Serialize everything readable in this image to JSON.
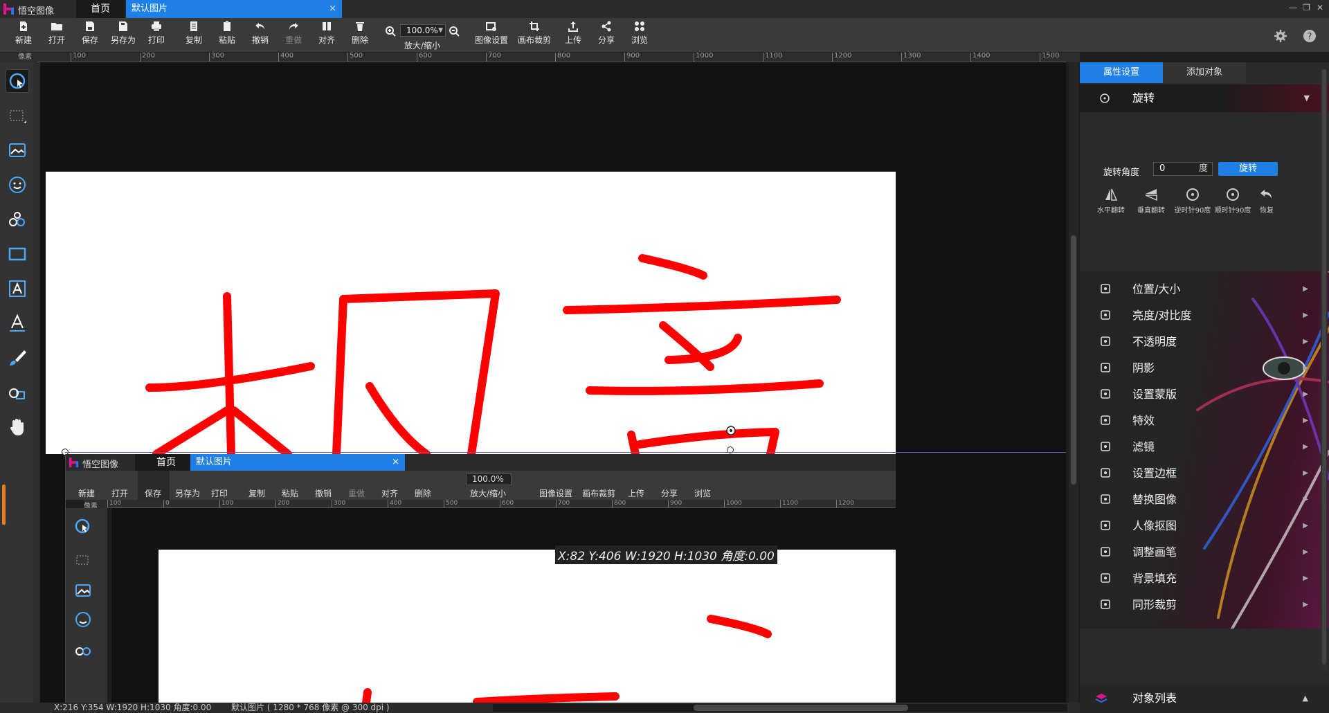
{
  "app": {
    "name": "悟空图像",
    "home_tab": "首页",
    "doc_tab": "默认图片",
    "close": "×"
  },
  "window_controls": {
    "min": "—",
    "restore": "❐",
    "close": "✕"
  },
  "toolbar": {
    "new": "新建",
    "open": "打开",
    "save": "保存",
    "save_as": "另存为",
    "print": "打印",
    "copy": "复制",
    "paste": "粘贴",
    "undo": "撤销",
    "redo": "重做",
    "align": "对齐",
    "delete": "删除",
    "zoom_value": "100.0%",
    "zoom_label": "放大/缩小",
    "image_settings": "图像设置",
    "canvas_crop": "画布裁剪",
    "upload": "上传",
    "share": "分享",
    "browse": "浏览"
  },
  "ruler": {
    "unit": "像素",
    "top_marks": [
      "100",
      "200",
      "300",
      "400",
      "500",
      "600",
      "700",
      "800",
      "900",
      "1000",
      "1100",
      "1200",
      "1300",
      "1400",
      "1500"
    ],
    "inner_marks": [
      "100",
      "0",
      "100",
      "200",
      "300",
      "400",
      "500",
      "600",
      "700",
      "800",
      "900",
      "1000",
      "1100",
      "1200"
    ]
  },
  "canvas": {
    "coord_overlay": "X:82 Y:406 W:1920 H:1030 角度:0.00"
  },
  "status": {
    "coords": "X:216 Y:354 W:1920 H:1030 角度:0.00",
    "doc_info": "默认图片 ( 1280 * 768 像素 @ 300 dpi )"
  },
  "right_panel": {
    "tab_props": "属性设置",
    "tab_add": "添加对象",
    "rotate_title": "旋转",
    "angle_label": "旋转角度",
    "angle_value": "0",
    "angle_unit": "度",
    "rotate_button": "旋转",
    "actions": [
      "水平翻转",
      "垂直翻转",
      "逆时针90度",
      "顺时针90度",
      "恢复"
    ],
    "menu": [
      "位置/大小",
      "亮度/对比度",
      "不透明度",
      "阴影",
      "设置蒙版",
      "特效",
      "滤镜",
      "设置边框",
      "替换图像",
      "人像抠图",
      "调整画笔",
      "背景填充",
      "同形裁剪"
    ],
    "object_list": "对象列表"
  },
  "colors": {
    "accent": "#1e7fe6",
    "stroke": "#ff0000",
    "panel": "#2a2a2a"
  }
}
